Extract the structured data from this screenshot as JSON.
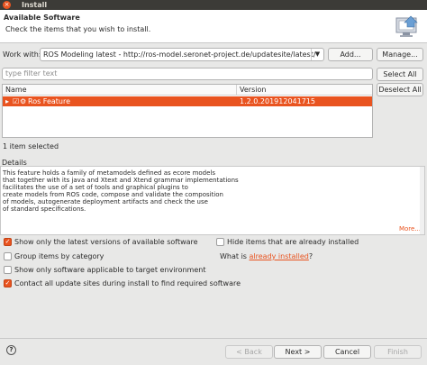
{
  "window": {
    "title": "Install"
  },
  "header": {
    "title": "Available Software",
    "subtitle": "Check the items that you wish to install."
  },
  "work_with": {
    "label": "Work with:",
    "value": "ROS Modeling latest - http://ros-model.seronet-project.de/updatesite/latest/",
    "add_label": "Add...",
    "manage_label": "Manage..."
  },
  "filter": {
    "placeholder": "type filter text",
    "select_all_label": "Select All",
    "deselect_all_label": "Deselect All"
  },
  "table": {
    "columns": [
      "Name",
      "Version"
    ],
    "rows": [
      {
        "name": "Ros Feature",
        "version": "1.2.0.201912041715",
        "checked": true,
        "selected": true
      }
    ]
  },
  "selection_status": "1 item selected",
  "details": {
    "label": "Details",
    "lines": [
      "This feature holds a family of metamodels defined as ecore models",
      "that together with its java and Xtext and Xtend grammar implementations",
      "facilitates the use of a set of tools and graphical plugins to",
      "create models from ROS code, compose and validate the composition",
      "of models, autogenerate deployment artifacts and check the use",
      "of standard specifications."
    ],
    "more_label": "More..."
  },
  "options": {
    "latest_versions": {
      "label": "Show only the latest versions of available software",
      "checked": true
    },
    "hide_installed": {
      "label": "Hide items that are already installed",
      "checked": false
    },
    "group_by_category": {
      "label": "Group items by category",
      "checked": false
    },
    "what_is_prefix": "What is ",
    "already_installed_link": "already installed",
    "what_is_suffix": "?",
    "target_env": {
      "label": "Show only software applicable to target environment",
      "checked": false
    },
    "contact_sites": {
      "label": "Contact all update sites during install to find required software",
      "checked": true
    }
  },
  "footer": {
    "back_label": "< Back",
    "next_label": "Next >",
    "cancel_label": "Cancel",
    "finish_label": "Finish"
  },
  "colors": {
    "accent": "#e95420",
    "titlebar": "#3c3b37"
  }
}
